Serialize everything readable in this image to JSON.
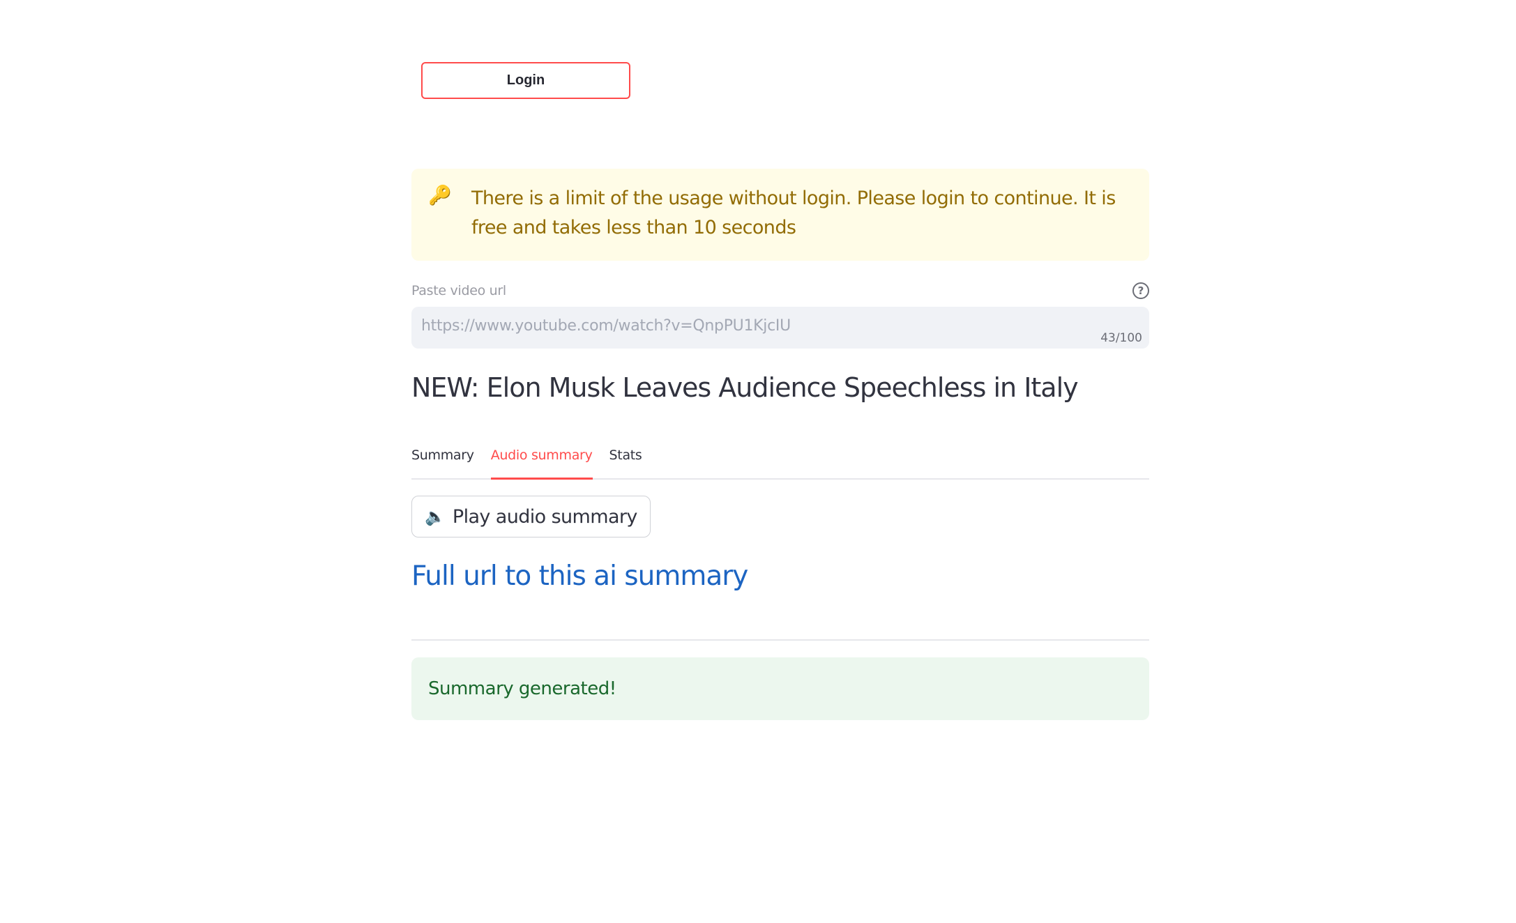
{
  "header": {
    "login_label": "Login"
  },
  "warning": {
    "icon": "key-icon",
    "message": "There is a limit of the usage without login. Please login to continue. It is free and takes less than 10 seconds"
  },
  "url_field": {
    "label": "Paste video url",
    "value": "https://www.youtube.com/watch?v=QnpPU1KjcIU",
    "counter": "43/100"
  },
  "video": {
    "title": "NEW: Elon Musk Leaves Audience Speechless in Italy"
  },
  "tabs": [
    {
      "label": "Summary",
      "active": false
    },
    {
      "label": "Audio summary",
      "active": true
    },
    {
      "label": "Stats",
      "active": false
    }
  ],
  "audio": {
    "play_label": "Play audio summary",
    "icon": "speaker-icon"
  },
  "link": {
    "full_url_label": "Full url to this ai summary"
  },
  "status": {
    "success_message": "Summary generated!"
  },
  "colors": {
    "accent": "#ff4b4b",
    "link": "#1c64c2",
    "warning_bg": "#fffce7",
    "warning_text": "#926c05",
    "success_bg": "#ecf7ee",
    "success_text": "#19682c"
  }
}
